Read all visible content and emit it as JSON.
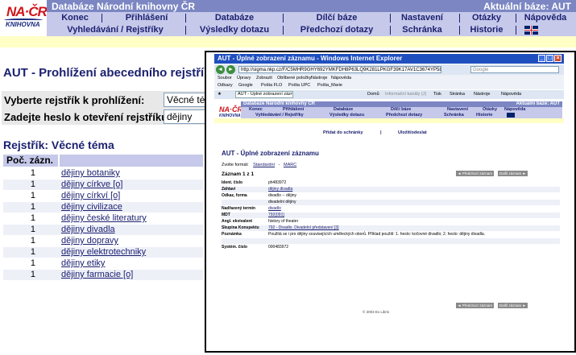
{
  "app": {
    "logo_text": "NA·ČR",
    "logo_sub": "KNIHOVNA",
    "db_title": "Databáze Národní knihovny ČR",
    "current_db": "Aktuální báze:  AUT",
    "menu1": [
      "Konec",
      "Přihlášení",
      "Databáze",
      "Dílčí báze",
      "Nastavení",
      "Otázky",
      "Nápověda"
    ],
    "menu2": [
      "Vyhledávání / Rejstříky",
      "Výsledky dotazu",
      "Předchozí dotazy",
      "Schránka",
      "Historie"
    ],
    "flag_icon": "uk-flag-icon"
  },
  "main": {
    "heading": "AUT - Prohlížení abecedního rejstříku",
    "select_label": "Vyberte rejstřík k prohlížení:",
    "select_value": "Věcné téma",
    "entry_label": "Zadejte heslo k otevření rejstříku:",
    "entry_value": "dějiny",
    "reg_heading": "Rejstřík:  Věcné téma",
    "col_count": "Poč. zázn.",
    "col_term": "",
    "rows": [
      {
        "count": "1",
        "term": "dějiny botaniky"
      },
      {
        "count": "1",
        "term": "dějiny církve [o]"
      },
      {
        "count": "1",
        "term": "dějiny církví [o]"
      },
      {
        "count": "1",
        "term": "dějiny civilizace"
      },
      {
        "count": "1",
        "term": "dějiny české literatury"
      },
      {
        "count": "1",
        "term": "dějiny divadla"
      },
      {
        "count": "1",
        "term": "dějiny dopravy"
      },
      {
        "count": "1",
        "term": "dějiny elektrotechniky"
      },
      {
        "count": "1",
        "term": "dějiny etiky"
      },
      {
        "count": "1",
        "term": "dějiny farmacie [o]"
      }
    ]
  },
  "ie": {
    "title": "AUT - Úplné zobrazení záznamu - Windows Internet Explorer",
    "url": "http://sigma.nkp.cz/F/C5MHR9GHY692YMKFDH8P63LQ9K281LPKGF39K17AV1C3674YP58-35783?func=find-",
    "search_placeholder": "Google",
    "menu": [
      "Soubor",
      "Úpravy",
      "Zobrazit",
      "Oblíbené položky",
      "Nástroje",
      "Nápověda"
    ],
    "links": [
      "Odkazy",
      "Google",
      "Pošta FLO",
      "Pošta UPC",
      "Pošta_Marie"
    ],
    "tab_label": "AUT - Úplné zobrazení záznamu",
    "toolbar": [
      "Domů",
      "Informační kanály (J)",
      "Tisk",
      "Stránka",
      "Nástroje",
      "Nápověda"
    ],
    "inner": {
      "logo_text": "NA·ČR",
      "logo_sub": "KNIHOVNA",
      "db_title": "Databáze Národní knihovny ČR",
      "current_db": "Aktuální báze:  AUT",
      "menu1": [
        "Konec",
        "Přihlášení",
        "Databáze",
        "Dílčí báze",
        "Nastavení",
        "Otázky",
        "Nápověda"
      ],
      "menu2": [
        "Vyhledávání / Rejstříky",
        "Výsledky dotazu",
        "Předchozí dotazy",
        "Schránka",
        "Historie"
      ],
      "action_add": "Přidat do schránky",
      "action_save": "Uložit/odeslat",
      "heading": "AUT - Úplné zobrazení záznamu",
      "format_label": "Zvolte formát:",
      "format_standard": "Standardní",
      "format_marc": "MARC",
      "record_label": "Záznam 1 z 1",
      "prev_btn": "◄ Předchozí záznam",
      "next_btn": "Další záznam ►",
      "fields": [
        {
          "k": "Ident. číslo",
          "v": "ph483972"
        },
        {
          "k": "Záhlaví",
          "v": "dějiny divadla",
          "link": true
        },
        {
          "k": "Odkaz, forma",
          "v": "divadlo -- dějiny"
        },
        {
          "k": "",
          "v": "divadelní dějiny"
        },
        {
          "k": "Nadřazený termín",
          "v": "divadlo",
          "link": true
        },
        {
          "k": "MDT",
          "v": "792(091)",
          "link": true
        },
        {
          "k": "Angl. ekvivalent",
          "v": "history of theater"
        },
        {
          "k": "Skupina Konspektu",
          "v": "792 - Divadlo. Divadelní představení [3]",
          "link": true
        },
        {
          "k": "Poznámka",
          "v": "Použitá se i pro dějiny souvisejících uměleckých oborů. Příklad použití: 1. heslo: kočovné divadlo; 2. heslo: dějiny divadla."
        },
        {
          "k": "",
          "v": ""
        },
        {
          "k": "Systém. číslo",
          "v": "000483972"
        }
      ],
      "footer": "© 2003 Ex Libris"
    }
  }
}
